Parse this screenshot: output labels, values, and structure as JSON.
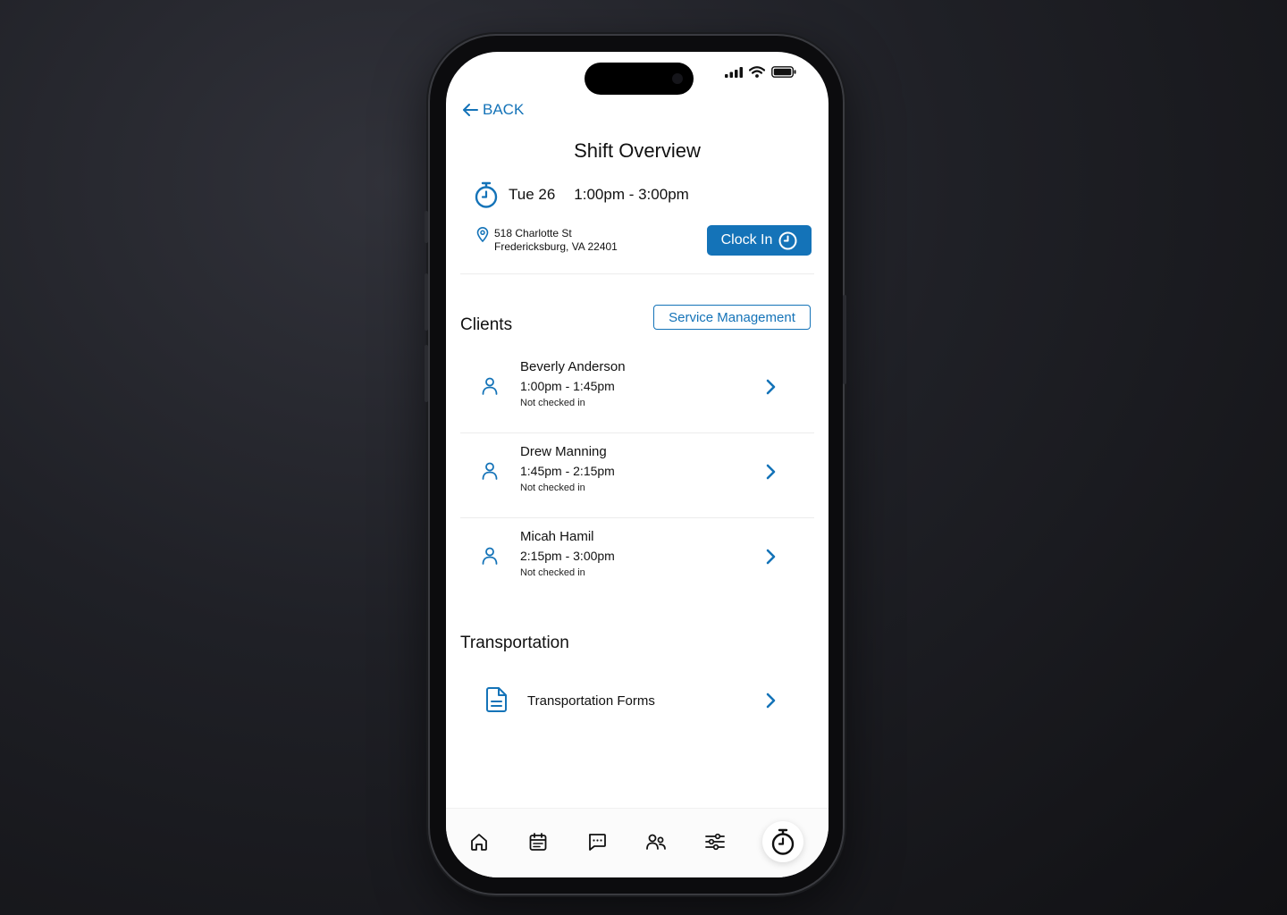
{
  "colors": {
    "accent": "#1473b8",
    "text": "#111111",
    "background": "#ffffff"
  },
  "status_bar": {
    "icons": [
      "signal-icon",
      "wifi-icon",
      "battery-icon"
    ]
  },
  "header": {
    "back_label": "BACK",
    "title": "Shift Overview"
  },
  "shift": {
    "date": "Tue 26",
    "time_range": "1:00pm - 3:00pm",
    "address_line1": "518 Charlotte St",
    "address_line2": "Fredericksburg, VA 22401",
    "clock_in_label": "Clock In"
  },
  "clients": {
    "title": "Clients",
    "service_management_label": "Service Management",
    "items": [
      {
        "name": "Beverly Anderson",
        "time": "1:00pm - 1:45pm",
        "status": "Not checked in"
      },
      {
        "name": "Drew Manning",
        "time": "1:45pm - 2:15pm",
        "status": "Not checked in"
      },
      {
        "name": "Micah Hamil",
        "time": "2:15pm - 3:00pm",
        "status": "Not checked in"
      }
    ]
  },
  "transportation": {
    "title": "Transportation",
    "forms_label": "Transportation Forms"
  },
  "tabbar": {
    "items": [
      "home-icon",
      "calendar-icon",
      "messages-icon",
      "users-icon",
      "settings-sliders-icon",
      "stopwatch-icon"
    ],
    "active": "stopwatch-icon"
  }
}
